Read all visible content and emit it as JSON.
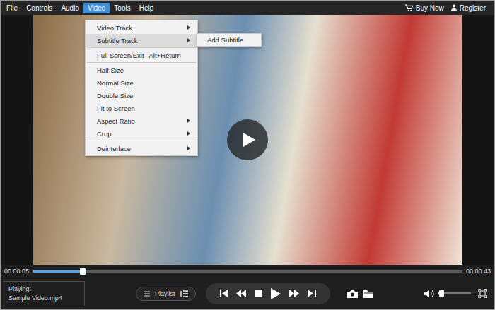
{
  "menu_bar": {
    "items": [
      {
        "label": "File",
        "selected": false
      },
      {
        "label": "Controls",
        "selected": false
      },
      {
        "label": "Audio",
        "selected": false
      },
      {
        "label": "Video",
        "selected": true
      },
      {
        "label": "Tools",
        "selected": false
      },
      {
        "label": "Help",
        "selected": false
      }
    ],
    "buy": "Buy Now",
    "register": "Register"
  },
  "video_menu": {
    "items": [
      {
        "label": "Video Track",
        "shortcut": "",
        "submenu": true,
        "selected": false,
        "separator_after": false
      },
      {
        "label": "Subtitle Track",
        "shortcut": "",
        "submenu": true,
        "selected": true,
        "separator_after": true
      },
      {
        "label": "Full Screen/Exit",
        "shortcut": "Alt+Return",
        "submenu": false,
        "selected": false,
        "separator_after": true
      },
      {
        "label": "Half Size",
        "shortcut": "",
        "submenu": false,
        "selected": false,
        "separator_after": false
      },
      {
        "label": "Normal Size",
        "shortcut": "",
        "submenu": false,
        "selected": false,
        "separator_after": false
      },
      {
        "label": "Double Size",
        "shortcut": "",
        "submenu": false,
        "selected": false,
        "separator_after": false
      },
      {
        "label": "Fit to Screen",
        "shortcut": "",
        "submenu": false,
        "selected": false,
        "separator_after": false
      },
      {
        "label": "Aspect Ratio",
        "shortcut": "",
        "submenu": true,
        "selected": false,
        "separator_after": false
      },
      {
        "label": "Crop",
        "shortcut": "",
        "submenu": true,
        "selected": false,
        "separator_after": true
      },
      {
        "label": "Deinterlace",
        "shortcut": "",
        "submenu": true,
        "selected": false,
        "separator_after": false
      }
    ]
  },
  "subtitle_submenu": {
    "items": [
      "Add Subtitle"
    ]
  },
  "progress": {
    "elapsed": "00:00:05",
    "total": "00:00:43",
    "level": 0.116
  },
  "now_playing": {
    "label": "Playing:",
    "file": "Sample Video.mp4"
  },
  "playlist_button": {
    "label": "Playlist"
  },
  "volume": {
    "level": 0.08
  }
}
